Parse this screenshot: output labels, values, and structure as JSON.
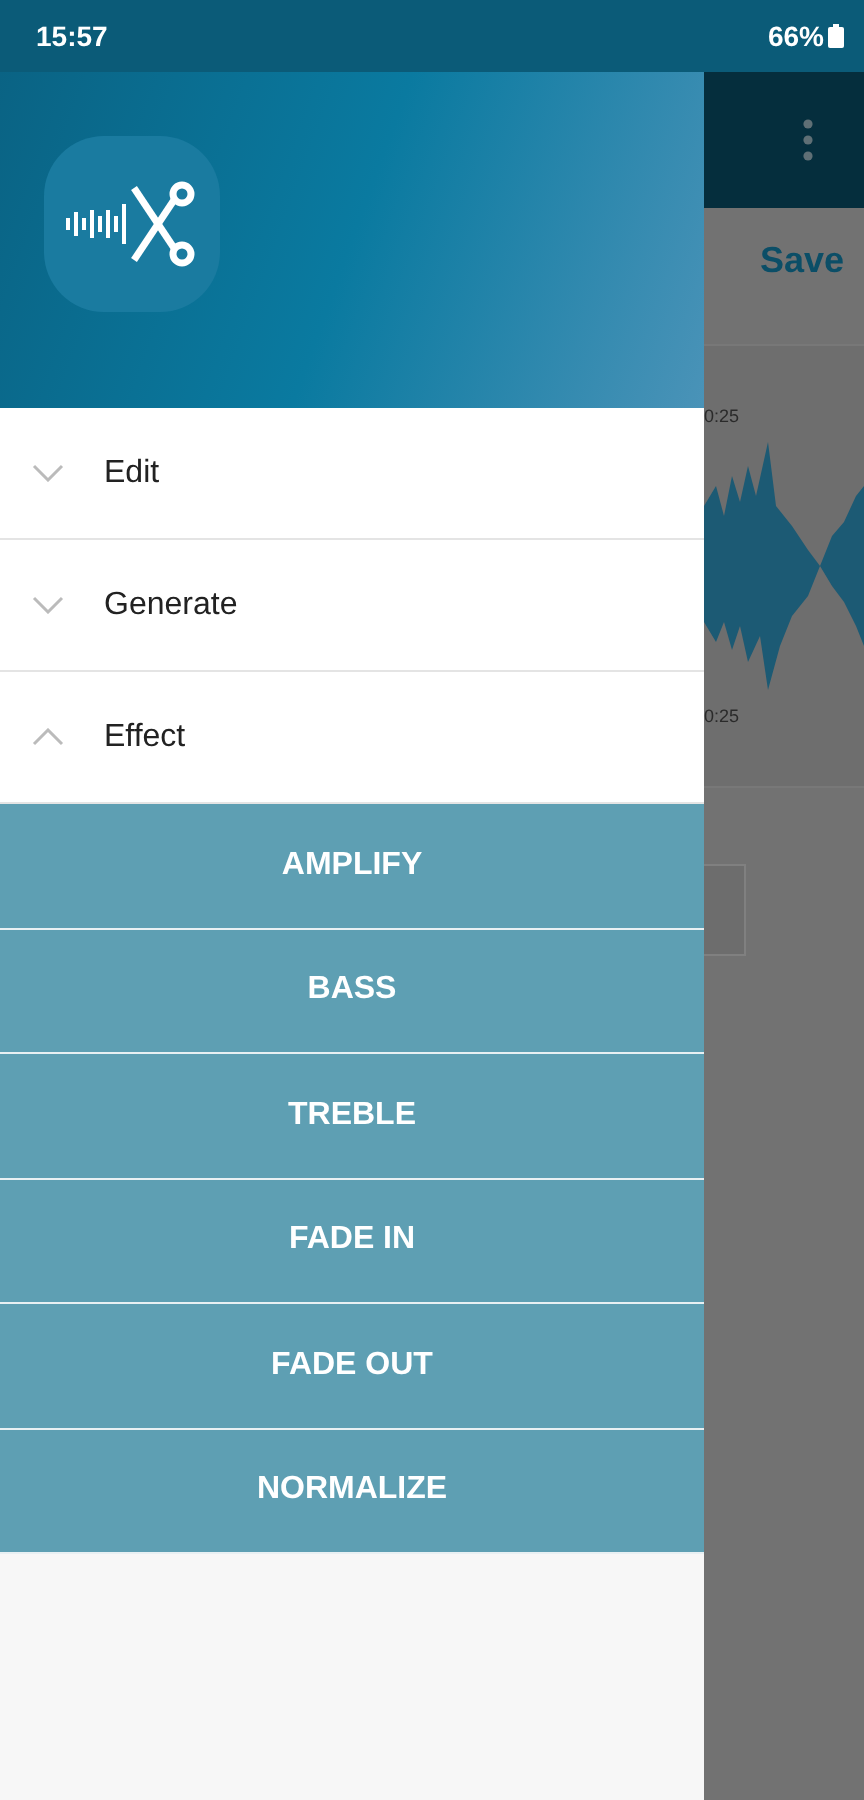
{
  "status_bar": {
    "time": "15:57",
    "battery": "66%"
  },
  "drawer": {
    "sections": [
      {
        "label": "Edit",
        "expanded": false
      },
      {
        "label": "Generate",
        "expanded": false
      },
      {
        "label": "Effect",
        "expanded": true,
        "items": [
          "AMPLIFY",
          "BASS",
          "TREBLE",
          "FADE IN",
          "FADE OUT",
          "NORMALIZE"
        ]
      }
    ]
  },
  "background": {
    "save": "Save",
    "timestamps": [
      "0:25",
      "0:25"
    ]
  }
}
